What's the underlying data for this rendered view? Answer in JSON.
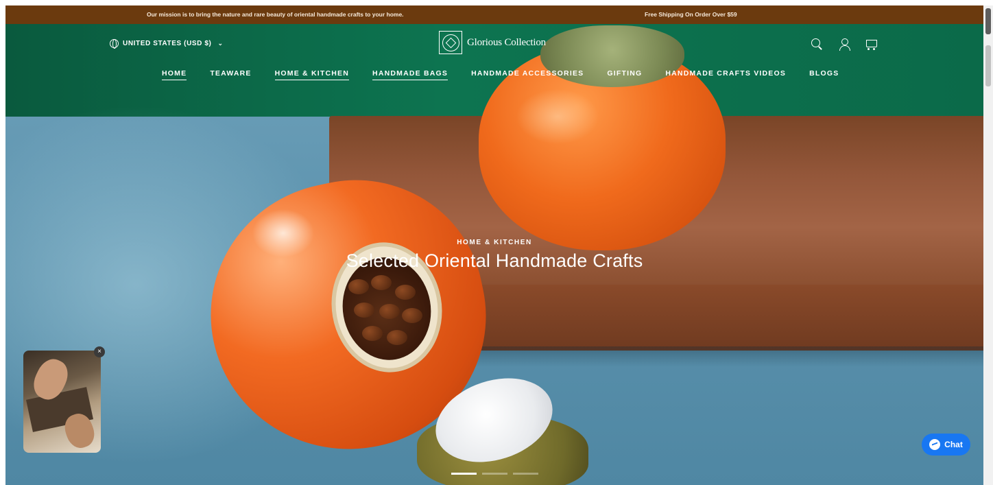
{
  "announcement": {
    "mission": "Our mission is to bring the nature and rare beauty of oriental handmade crafts to your home.",
    "shipping": "Free Shipping On Order Over $59"
  },
  "header": {
    "currency": "UNITED STATES (USD $)",
    "logo_text": "Glorious Collection",
    "icons": [
      "search-icon",
      "user-icon",
      "cart-icon"
    ]
  },
  "nav": {
    "items": [
      {
        "label": "HOME",
        "underlined": true
      },
      {
        "label": "TEAWARE",
        "underlined": false
      },
      {
        "label": "HOME & KITCHEN",
        "underlined": true
      },
      {
        "label": "HANDMADE BAGS",
        "underlined": true
      },
      {
        "label": "HANDMADE ACCESSORIES",
        "underlined": false
      },
      {
        "label": "GIFTING",
        "underlined": false
      },
      {
        "label": "HANDMADE CRAFTS VIDEOS",
        "underlined": false
      },
      {
        "label": "BLOGS",
        "underlined": false
      }
    ]
  },
  "hero": {
    "subtitle": "HOME & KITCHEN",
    "title": "Selected Oriental Handmade Crafts",
    "slides_total": 3,
    "active_slide": 1
  },
  "widgets": {
    "close_glyph": "×",
    "chat_label": "Chat"
  },
  "colors": {
    "announcement_bg": "#6b3a0e",
    "chat_button": "#1877f2"
  }
}
